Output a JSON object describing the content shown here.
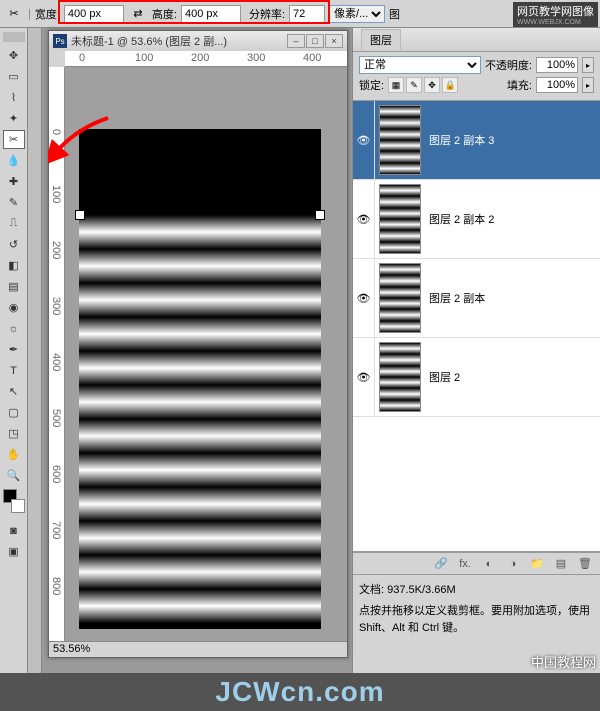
{
  "options_bar": {
    "crop_icon": "crop-icon",
    "width_label": "宽度:",
    "width_value": "400 px",
    "swap_icon": "⇄",
    "height_label": "高度:",
    "height_value": "400 px",
    "resolution_label": "分辨率:",
    "resolution_value": "72",
    "units_label": "像素/...",
    "menu_label": "图"
  },
  "watermark_top": "网页教学网图像",
  "watermark_top_sub": "WWW.WEBJX.COM",
  "document": {
    "title": "未标题-1 @ 53.6% (图层 2 副...)",
    "ruler_marks_h": [
      "0",
      "100",
      "200",
      "300",
      "400"
    ],
    "ruler_marks_v": [
      "0",
      "100",
      "200",
      "300",
      "400",
      "500",
      "600",
      "700",
      "800"
    ],
    "zoom": "53.56%"
  },
  "layers_panel": {
    "tab": "图层",
    "blend_mode": "正常",
    "opacity_label": "不透明度:",
    "opacity_value": "100%",
    "lock_label": "锁定:",
    "fill_label": "填充:",
    "fill_value": "100%",
    "layers": [
      {
        "name": "图层 2 副本 3",
        "selected": true,
        "visible": true
      },
      {
        "name": "图层 2 副本 2",
        "selected": false,
        "visible": true
      },
      {
        "name": "图层 2 副本",
        "selected": false,
        "visible": true
      },
      {
        "name": "图层 2",
        "selected": false,
        "visible": true
      }
    ]
  },
  "info_panel": {
    "doc_size_label": "文档:",
    "doc_size_value": "937.5K/3.66M",
    "hint": "点按并拖移以定义裁剪框。要用附加选项，使用 Shift、Alt 和 Ctrl 键。"
  },
  "bottom_wm1": "中国教程网",
  "bottom_wm2": "JCWcn.com"
}
